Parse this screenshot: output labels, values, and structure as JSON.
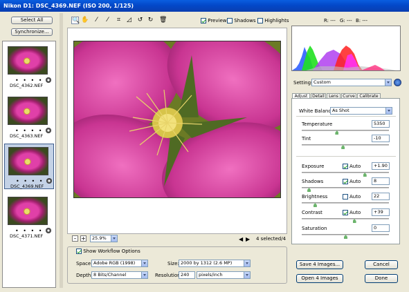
{
  "window": {
    "title": "Nikon D1:  DSC_4369.NEF  (ISO 200, 1/125)"
  },
  "filmstrip": {
    "select_all_label": "Select All",
    "synchronize_label": "Synchronize...",
    "thumbnails": [
      {
        "name": "DSC_4362.NEF",
        "rating": "• • • • •",
        "selected": false
      },
      {
        "name": "DSC_4363.NEF",
        "rating": "• • • • •",
        "selected": false
      },
      {
        "name": "DSC_4369.NEF",
        "rating": "• • • • •",
        "selected": true
      },
      {
        "name": "DSC_4371.NEF",
        "rating": "• • • • •",
        "selected": false
      }
    ]
  },
  "toolbar": {
    "tools": [
      "zoom-icon",
      "hand-icon",
      "white-balance-icon",
      "color-sampler-icon",
      "crop-icon",
      "straighten-icon",
      "rotate-left-icon",
      "rotate-right-icon",
      "trash-icon"
    ],
    "preview_label": "Preview",
    "preview_checked": true,
    "shadows_label": "Shadows",
    "shadows_checked": false,
    "highlights_label": "Highlights",
    "highlights_checked": false,
    "r_label": "R:",
    "r_value": "---",
    "g_label": "G:",
    "g_value": "---",
    "b_label": "B:",
    "b_value": "---"
  },
  "preview": {
    "zoom_value": "25.9%",
    "selection_status": "4 selected/4",
    "zoom_out_label": "–",
    "zoom_in_label": "+"
  },
  "workflow": {
    "show_options_label": "Show Workflow Options",
    "show_options_checked": true,
    "space_label": "Space:",
    "space_value": "Adobe RGB (1998)",
    "size_label": "Size:",
    "size_value": "2000 by 1312  (2.6 MP)",
    "depth_label": "Depth:",
    "depth_value": "8 Bits/Channel",
    "resolution_label": "Resolution:",
    "resolution_value": "240",
    "resolution_unit": "pixels/inch"
  },
  "settings": {
    "label": "Settings:",
    "value": "Custom",
    "tabs": [
      "Adjust",
      "Detail",
      "Lens",
      "Curve",
      "Calibrate"
    ],
    "active_tab": "Adjust",
    "white_balance_label": "White Balance:",
    "white_balance_value": "As Shot",
    "sliders": [
      {
        "label": "Temperature",
        "value": "5350",
        "position": 0.4,
        "has_auto": false
      },
      {
        "label": "Tint",
        "value": "-10",
        "position": 0.47,
        "has_auto": false
      },
      {
        "label": "Exposure",
        "value": "+1.90",
        "position": 0.72,
        "has_auto": true,
        "auto_checked": true
      },
      {
        "label": "Shadows",
        "value": "8",
        "position": 0.08,
        "has_auto": true,
        "auto_checked": true
      },
      {
        "label": "Brightness",
        "value": "22",
        "position": 0.15,
        "has_auto": true,
        "auto_checked": false
      },
      {
        "label": "Contrast",
        "value": "+39",
        "position": 0.6,
        "has_auto": true,
        "auto_checked": true
      },
      {
        "label": "Saturation",
        "value": "0",
        "position": 0.5,
        "has_auto": false
      }
    ],
    "auto_label": "Auto"
  },
  "actions": {
    "save_label": "Save 4 Images...",
    "open_label": "Open 4 Images",
    "cancel_label": "Cancel",
    "done_label": "Done"
  },
  "colors": {
    "titlebar": "#0348c8",
    "flower": "#d94aa4",
    "slider_thumb": "#6cb46c"
  }
}
